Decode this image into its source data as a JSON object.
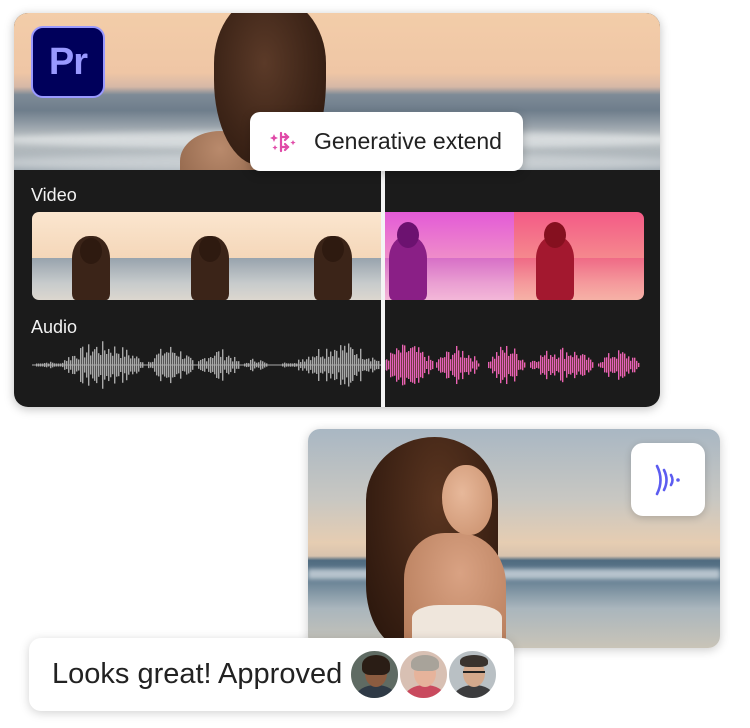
{
  "editor": {
    "app_badge": "Pr",
    "generative_extend_label": "Generative extend",
    "video_track_label": "Video",
    "audio_track_label": "Audio"
  },
  "preview": {
    "voice_icon": "audio-waves-icon"
  },
  "comment": {
    "text": "Looks great! Approved",
    "avatars": [
      "reviewer-avatar-1",
      "reviewer-avatar-2",
      "reviewer-avatar-3"
    ]
  },
  "colors": {
    "pr_badge_bg": "#00005b",
    "pr_badge_text": "#9999ff",
    "timeline_bg": "#1b1b1b",
    "waveform_gray": "#a9a9a9",
    "extend_purple": "#c56bf0",
    "extend_pink": "#f25ca8",
    "extend_coral": "#f56a78",
    "voice_icon": "#5c5cf0"
  }
}
